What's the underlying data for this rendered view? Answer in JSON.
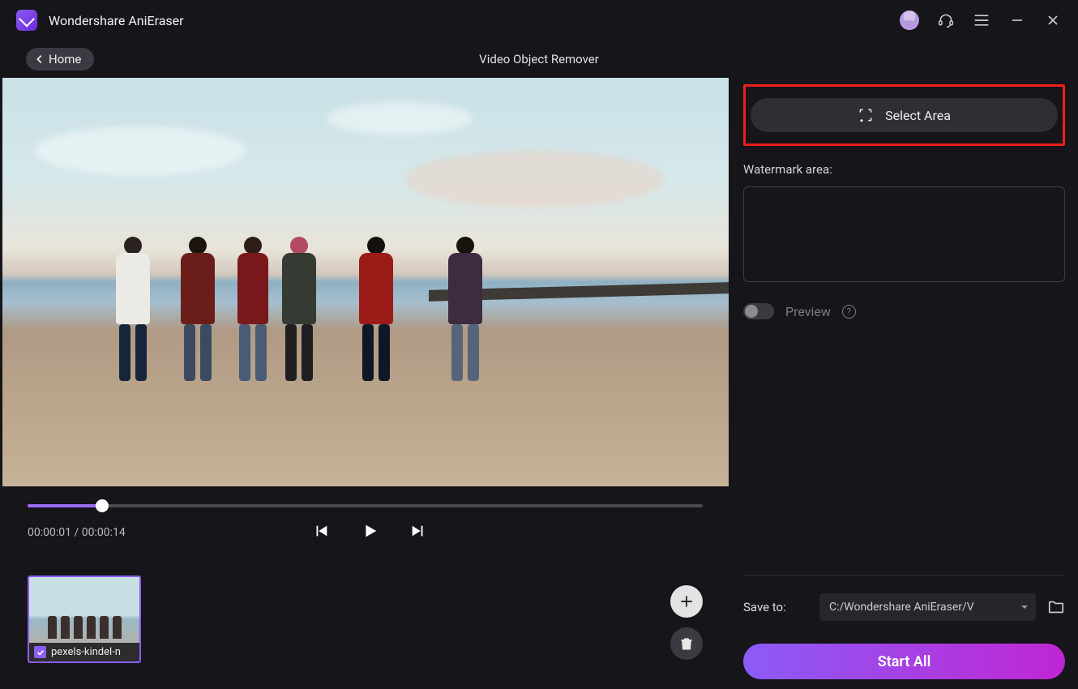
{
  "app": {
    "title": "Wondershare AniEraser"
  },
  "header": {
    "home_label": "Home",
    "page_title": "Video Object Remover"
  },
  "player": {
    "current_time": "00:00:01",
    "duration": "00:00:14",
    "progress_percent": 11
  },
  "thumbnail": {
    "filename": "pexels-kindel-n",
    "checked": true
  },
  "sidebar": {
    "select_area_label": "Select Area",
    "watermark_label": "Watermark area:",
    "preview_label": "Preview",
    "preview_on": false
  },
  "output": {
    "save_to_label": "Save to:",
    "save_path": "C:/Wondershare AniEraser/V",
    "start_label": "Start All"
  }
}
